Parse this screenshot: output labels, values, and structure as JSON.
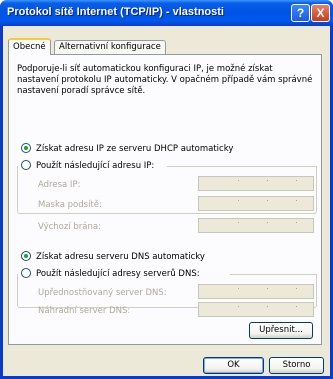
{
  "window": {
    "title": "Protokol sítě Internet (TCP/IP) - vlastnosti",
    "help_label": "?",
    "close_label": "X"
  },
  "tabs": [
    {
      "label": "Obecné",
      "active": true
    },
    {
      "label": "Alternativní konfigurace",
      "active": false
    }
  ],
  "description": "Podporuje-li síť automatickou konfiguraci IP, je možné získat nastavení protokolu IP automaticky. V opačném případě vám správné nastavení poradí správce sítě.",
  "ip_options": {
    "auto_label": "Získat adresu IP ze serveru DHCP automaticky",
    "manual_label": "Použít následující adresu IP:",
    "selected": "auto",
    "fields": [
      {
        "label": "Adresa IP:",
        "value": ""
      },
      {
        "label": "Maska podsítě:",
        "value": ""
      },
      {
        "label": "Výchozí brána:",
        "value": ""
      }
    ]
  },
  "dns_options": {
    "auto_label": "Získat adresu serveru DNS automaticky",
    "manual_label": "Použít následující adresy serverů DNS:",
    "selected": "auto",
    "fields": [
      {
        "label": "Upřednostňovaný server DNS:",
        "value": ""
      },
      {
        "label": "Náhradní server DNS:",
        "value": ""
      }
    ]
  },
  "buttons": {
    "advanced": "Upřesnit...",
    "ok": "OK",
    "cancel": "Storno"
  }
}
